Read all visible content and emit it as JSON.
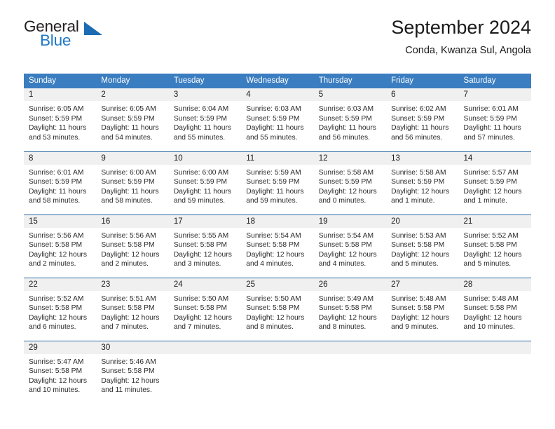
{
  "brand": {
    "name_part1": "General",
    "name_part2": "Blue",
    "logo_icon": "triangle-mark",
    "accent_color": "#2077c4"
  },
  "header": {
    "title": "September 2024",
    "subtitle": "Conda, Kwanza Sul, Angola"
  },
  "colors": {
    "header_blue": "#3a7dc0",
    "row_rule_blue": "#2f6ca8",
    "daynum_band": "#f0f0f0"
  },
  "weekday_headers": [
    "Sunday",
    "Monday",
    "Tuesday",
    "Wednesday",
    "Thursday",
    "Friday",
    "Saturday"
  ],
  "weeks": [
    [
      {
        "day": "1",
        "sunrise": "Sunrise: 6:05 AM",
        "sunset": "Sunset: 5:59 PM",
        "daylight_line1": "Daylight: 11 hours",
        "daylight_line2": "and 53 minutes."
      },
      {
        "day": "2",
        "sunrise": "Sunrise: 6:05 AM",
        "sunset": "Sunset: 5:59 PM",
        "daylight_line1": "Daylight: 11 hours",
        "daylight_line2": "and 54 minutes."
      },
      {
        "day": "3",
        "sunrise": "Sunrise: 6:04 AM",
        "sunset": "Sunset: 5:59 PM",
        "daylight_line1": "Daylight: 11 hours",
        "daylight_line2": "and 55 minutes."
      },
      {
        "day": "4",
        "sunrise": "Sunrise: 6:03 AM",
        "sunset": "Sunset: 5:59 PM",
        "daylight_line1": "Daylight: 11 hours",
        "daylight_line2": "and 55 minutes."
      },
      {
        "day": "5",
        "sunrise": "Sunrise: 6:03 AM",
        "sunset": "Sunset: 5:59 PM",
        "daylight_line1": "Daylight: 11 hours",
        "daylight_line2": "and 56 minutes."
      },
      {
        "day": "6",
        "sunrise": "Sunrise: 6:02 AM",
        "sunset": "Sunset: 5:59 PM",
        "daylight_line1": "Daylight: 11 hours",
        "daylight_line2": "and 56 minutes."
      },
      {
        "day": "7",
        "sunrise": "Sunrise: 6:01 AM",
        "sunset": "Sunset: 5:59 PM",
        "daylight_line1": "Daylight: 11 hours",
        "daylight_line2": "and 57 minutes."
      }
    ],
    [
      {
        "day": "8",
        "sunrise": "Sunrise: 6:01 AM",
        "sunset": "Sunset: 5:59 PM",
        "daylight_line1": "Daylight: 11 hours",
        "daylight_line2": "and 58 minutes."
      },
      {
        "day": "9",
        "sunrise": "Sunrise: 6:00 AM",
        "sunset": "Sunset: 5:59 PM",
        "daylight_line1": "Daylight: 11 hours",
        "daylight_line2": "and 58 minutes."
      },
      {
        "day": "10",
        "sunrise": "Sunrise: 6:00 AM",
        "sunset": "Sunset: 5:59 PM",
        "daylight_line1": "Daylight: 11 hours",
        "daylight_line2": "and 59 minutes."
      },
      {
        "day": "11",
        "sunrise": "Sunrise: 5:59 AM",
        "sunset": "Sunset: 5:59 PM",
        "daylight_line1": "Daylight: 11 hours",
        "daylight_line2": "and 59 minutes."
      },
      {
        "day": "12",
        "sunrise": "Sunrise: 5:58 AM",
        "sunset": "Sunset: 5:59 PM",
        "daylight_line1": "Daylight: 12 hours",
        "daylight_line2": "and 0 minutes."
      },
      {
        "day": "13",
        "sunrise": "Sunrise: 5:58 AM",
        "sunset": "Sunset: 5:59 PM",
        "daylight_line1": "Daylight: 12 hours",
        "daylight_line2": "and 1 minute."
      },
      {
        "day": "14",
        "sunrise": "Sunrise: 5:57 AM",
        "sunset": "Sunset: 5:59 PM",
        "daylight_line1": "Daylight: 12 hours",
        "daylight_line2": "and 1 minute."
      }
    ],
    [
      {
        "day": "15",
        "sunrise": "Sunrise: 5:56 AM",
        "sunset": "Sunset: 5:58 PM",
        "daylight_line1": "Daylight: 12 hours",
        "daylight_line2": "and 2 minutes."
      },
      {
        "day": "16",
        "sunrise": "Sunrise: 5:56 AM",
        "sunset": "Sunset: 5:58 PM",
        "daylight_line1": "Daylight: 12 hours",
        "daylight_line2": "and 2 minutes."
      },
      {
        "day": "17",
        "sunrise": "Sunrise: 5:55 AM",
        "sunset": "Sunset: 5:58 PM",
        "daylight_line1": "Daylight: 12 hours",
        "daylight_line2": "and 3 minutes."
      },
      {
        "day": "18",
        "sunrise": "Sunrise: 5:54 AM",
        "sunset": "Sunset: 5:58 PM",
        "daylight_line1": "Daylight: 12 hours",
        "daylight_line2": "and 4 minutes."
      },
      {
        "day": "19",
        "sunrise": "Sunrise: 5:54 AM",
        "sunset": "Sunset: 5:58 PM",
        "daylight_line1": "Daylight: 12 hours",
        "daylight_line2": "and 4 minutes."
      },
      {
        "day": "20",
        "sunrise": "Sunrise: 5:53 AM",
        "sunset": "Sunset: 5:58 PM",
        "daylight_line1": "Daylight: 12 hours",
        "daylight_line2": "and 5 minutes."
      },
      {
        "day": "21",
        "sunrise": "Sunrise: 5:52 AM",
        "sunset": "Sunset: 5:58 PM",
        "daylight_line1": "Daylight: 12 hours",
        "daylight_line2": "and 5 minutes."
      }
    ],
    [
      {
        "day": "22",
        "sunrise": "Sunrise: 5:52 AM",
        "sunset": "Sunset: 5:58 PM",
        "daylight_line1": "Daylight: 12 hours",
        "daylight_line2": "and 6 minutes."
      },
      {
        "day": "23",
        "sunrise": "Sunrise: 5:51 AM",
        "sunset": "Sunset: 5:58 PM",
        "daylight_line1": "Daylight: 12 hours",
        "daylight_line2": "and 7 minutes."
      },
      {
        "day": "24",
        "sunrise": "Sunrise: 5:50 AM",
        "sunset": "Sunset: 5:58 PM",
        "daylight_line1": "Daylight: 12 hours",
        "daylight_line2": "and 7 minutes."
      },
      {
        "day": "25",
        "sunrise": "Sunrise: 5:50 AM",
        "sunset": "Sunset: 5:58 PM",
        "daylight_line1": "Daylight: 12 hours",
        "daylight_line2": "and 8 minutes."
      },
      {
        "day": "26",
        "sunrise": "Sunrise: 5:49 AM",
        "sunset": "Sunset: 5:58 PM",
        "daylight_line1": "Daylight: 12 hours",
        "daylight_line2": "and 8 minutes."
      },
      {
        "day": "27",
        "sunrise": "Sunrise: 5:48 AM",
        "sunset": "Sunset: 5:58 PM",
        "daylight_line1": "Daylight: 12 hours",
        "daylight_line2": "and 9 minutes."
      },
      {
        "day": "28",
        "sunrise": "Sunrise: 5:48 AM",
        "sunset": "Sunset: 5:58 PM",
        "daylight_line1": "Daylight: 12 hours",
        "daylight_line2": "and 10 minutes."
      }
    ],
    [
      {
        "day": "29",
        "sunrise": "Sunrise: 5:47 AM",
        "sunset": "Sunset: 5:58 PM",
        "daylight_line1": "Daylight: 12 hours",
        "daylight_line2": "and 10 minutes."
      },
      {
        "day": "30",
        "sunrise": "Sunrise: 5:46 AM",
        "sunset": "Sunset: 5:58 PM",
        "daylight_line1": "Daylight: 12 hours",
        "daylight_line2": "and 11 minutes."
      },
      {
        "day": "",
        "sunrise": "",
        "sunset": "",
        "daylight_line1": "",
        "daylight_line2": ""
      },
      {
        "day": "",
        "sunrise": "",
        "sunset": "",
        "daylight_line1": "",
        "daylight_line2": ""
      },
      {
        "day": "",
        "sunrise": "",
        "sunset": "",
        "daylight_line1": "",
        "daylight_line2": ""
      },
      {
        "day": "",
        "sunrise": "",
        "sunset": "",
        "daylight_line1": "",
        "daylight_line2": ""
      },
      {
        "day": "",
        "sunrise": "",
        "sunset": "",
        "daylight_line1": "",
        "daylight_line2": ""
      }
    ]
  ]
}
